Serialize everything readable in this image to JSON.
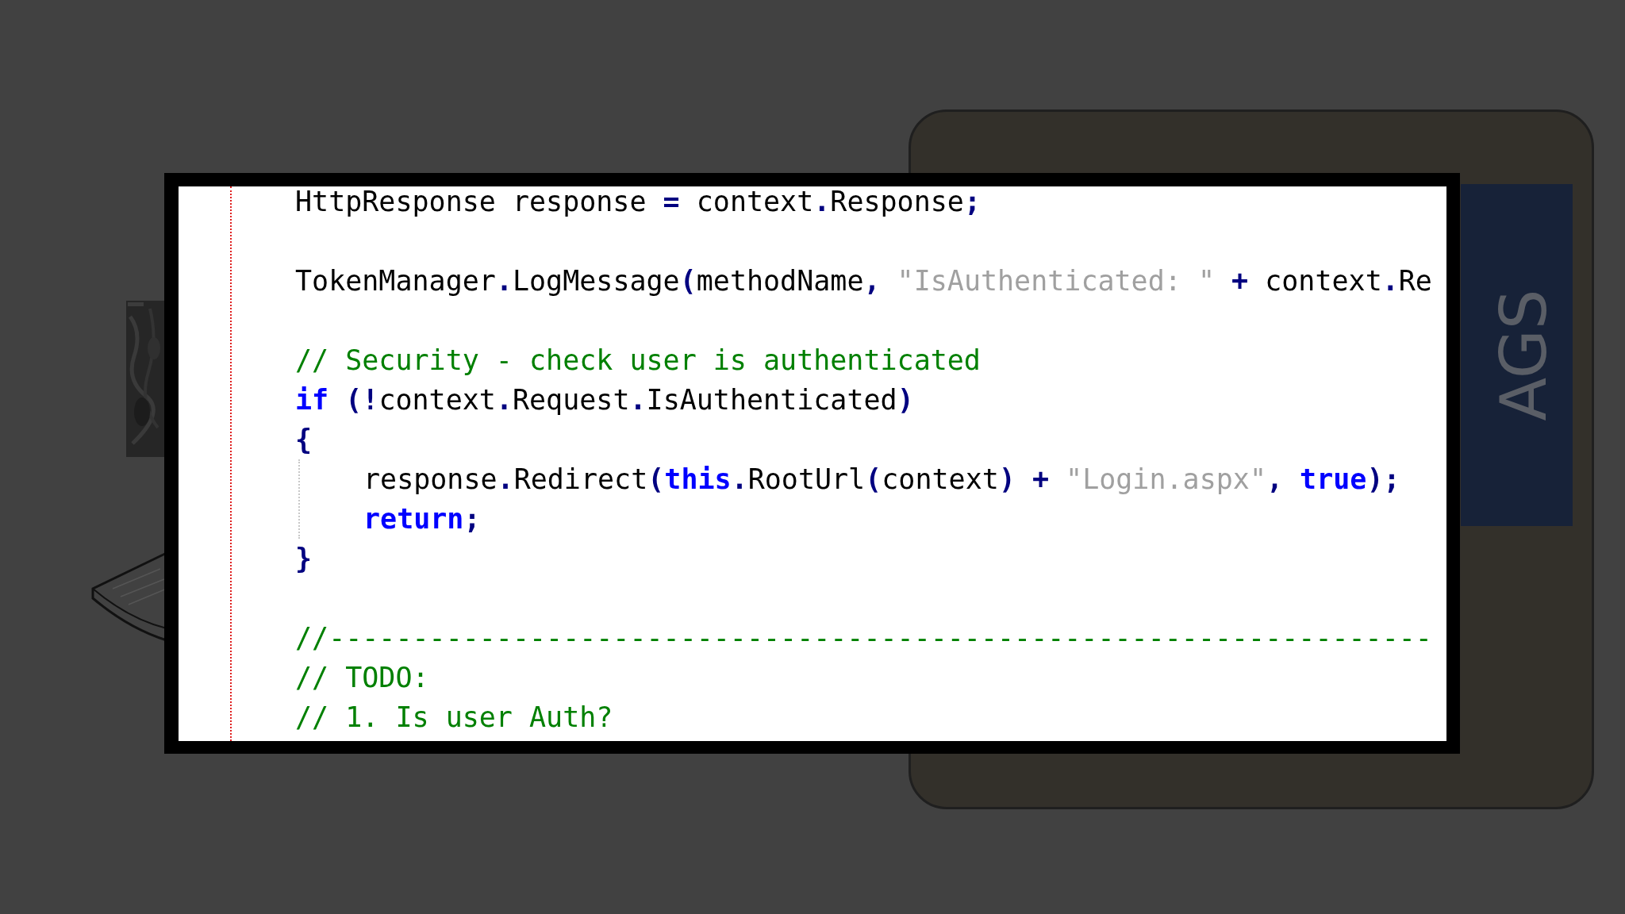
{
  "side_panel": {
    "label": "AGS"
  },
  "editor": {
    "lines": [
      {
        "kind": "code",
        "tokens": [
          {
            "kind": "plain",
            "text": "HttpResponse response "
          },
          {
            "kind": "op",
            "text": "="
          },
          {
            "kind": "plain",
            "text": " context"
          },
          {
            "kind": "op",
            "text": "."
          },
          {
            "kind": "plain",
            "text": "Response"
          },
          {
            "kind": "op",
            "text": ";"
          }
        ]
      },
      {
        "kind": "blank"
      },
      {
        "kind": "code",
        "tokens": [
          {
            "kind": "plain",
            "text": "TokenManager"
          },
          {
            "kind": "op",
            "text": "."
          },
          {
            "kind": "plain",
            "text": "LogMessage"
          },
          {
            "kind": "op",
            "text": "("
          },
          {
            "kind": "plain",
            "text": "methodName"
          },
          {
            "kind": "op",
            "text": ","
          },
          {
            "kind": "string",
            "text": " \"IsAuthenticated: \""
          },
          {
            "kind": "op",
            "text": " +"
          },
          {
            "kind": "plain",
            "text": " context"
          },
          {
            "kind": "op",
            "text": "."
          },
          {
            "kind": "plain",
            "text": "Re"
          }
        ]
      },
      {
        "kind": "blank"
      },
      {
        "kind": "code",
        "tokens": [
          {
            "kind": "comment",
            "text": "// Security - check user is authenticated"
          }
        ]
      },
      {
        "kind": "code",
        "tokens": [
          {
            "kind": "keyword",
            "text": "if"
          },
          {
            "kind": "op",
            "text": " (!"
          },
          {
            "kind": "plain",
            "text": "context"
          },
          {
            "kind": "op",
            "text": "."
          },
          {
            "kind": "plain",
            "text": "Request"
          },
          {
            "kind": "op",
            "text": "."
          },
          {
            "kind": "plain",
            "text": "IsAuthenticated"
          },
          {
            "kind": "op",
            "text": ")"
          }
        ]
      },
      {
        "kind": "code",
        "tokens": [
          {
            "kind": "op",
            "text": "{"
          }
        ],
        "children": [
          {
            "kind": "code",
            "tokens": [
              {
                "kind": "plain",
                "text": "response"
              },
              {
                "kind": "op",
                "text": "."
              },
              {
                "kind": "plain",
                "text": "Redirect"
              },
              {
                "kind": "op",
                "text": "("
              },
              {
                "kind": "keyword",
                "text": "this"
              },
              {
                "kind": "op",
                "text": "."
              },
              {
                "kind": "plain",
                "text": "RootUrl"
              },
              {
                "kind": "op",
                "text": "("
              },
              {
                "kind": "plain",
                "text": "context"
              },
              {
                "kind": "op",
                "text": ") +"
              },
              {
                "kind": "string",
                "text": " \"Login.aspx\""
              },
              {
                "kind": "op",
                "text": ","
              },
              {
                "kind": "keyword",
                "text": " true"
              },
              {
                "kind": "op",
                "text": ");"
              }
            ]
          },
          {
            "kind": "code",
            "tokens": [
              {
                "kind": "keyword",
                "text": "return"
              },
              {
                "kind": "op",
                "text": ";"
              }
            ]
          }
        ]
      },
      {
        "kind": "code",
        "tokens": [
          {
            "kind": "op",
            "text": "}"
          }
        ]
      },
      {
        "kind": "blank"
      },
      {
        "kind": "code",
        "tokens": [
          {
            "kind": "comment",
            "text": "//------------------------------------------------------------------"
          }
        ]
      },
      {
        "kind": "code",
        "tokens": [
          {
            "kind": "comment",
            "text": "// TODO:"
          }
        ]
      },
      {
        "kind": "code",
        "tokens": [
          {
            "kind": "comment",
            "text": "// 1. Is user Auth?"
          }
        ]
      }
    ]
  }
}
